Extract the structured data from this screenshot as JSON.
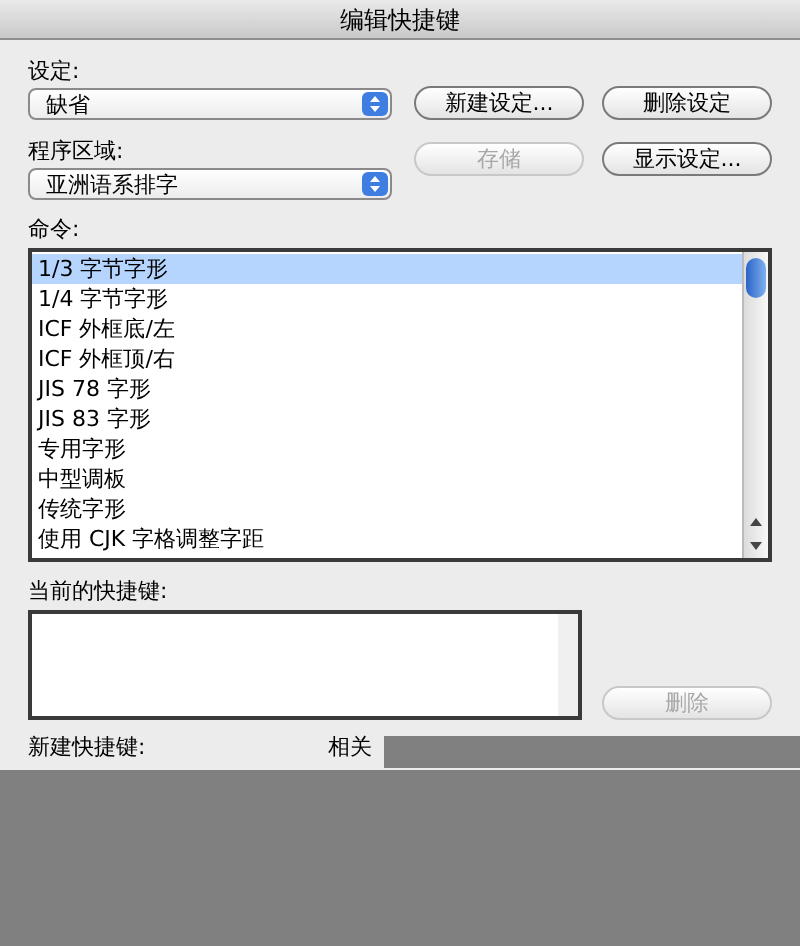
{
  "window": {
    "title": "编辑快捷键"
  },
  "set": {
    "label": "设定:",
    "value": "缺省"
  },
  "area": {
    "label": "程序区域:",
    "value": "亚洲语系排字"
  },
  "buttons": [
    {
      "label": "新建设定...",
      "disabled": false
    },
    {
      "label": "删除设定",
      "disabled": false
    },
    {
      "label": "存储",
      "disabled": true
    },
    {
      "label": "显示设定...",
      "disabled": false
    }
  ],
  "commands": {
    "label": "命令:",
    "items": [
      {
        "text": "1/3 字节字形",
        "selected": true
      },
      {
        "text": "1/4 字节字形",
        "selected": false
      },
      {
        "text": "ICF 外框底/左",
        "selected": false
      },
      {
        "text": "ICF 外框顶/右",
        "selected": false
      },
      {
        "text": "JIS 78 字形",
        "selected": false
      },
      {
        "text": "JIS 83 字形",
        "selected": false
      },
      {
        "text": "专用字形",
        "selected": false
      },
      {
        "text": "中型调板",
        "selected": false
      },
      {
        "text": "传统字形",
        "selected": false
      },
      {
        "text": "使用 CJK 字格调整字距",
        "selected": false
      }
    ]
  },
  "current": {
    "label": "当前的快捷键:",
    "remove_button": {
      "label": "删除",
      "disabled": true
    }
  },
  "new_shortcut": {
    "label": "新建快捷键:",
    "column_2": "相关"
  }
}
